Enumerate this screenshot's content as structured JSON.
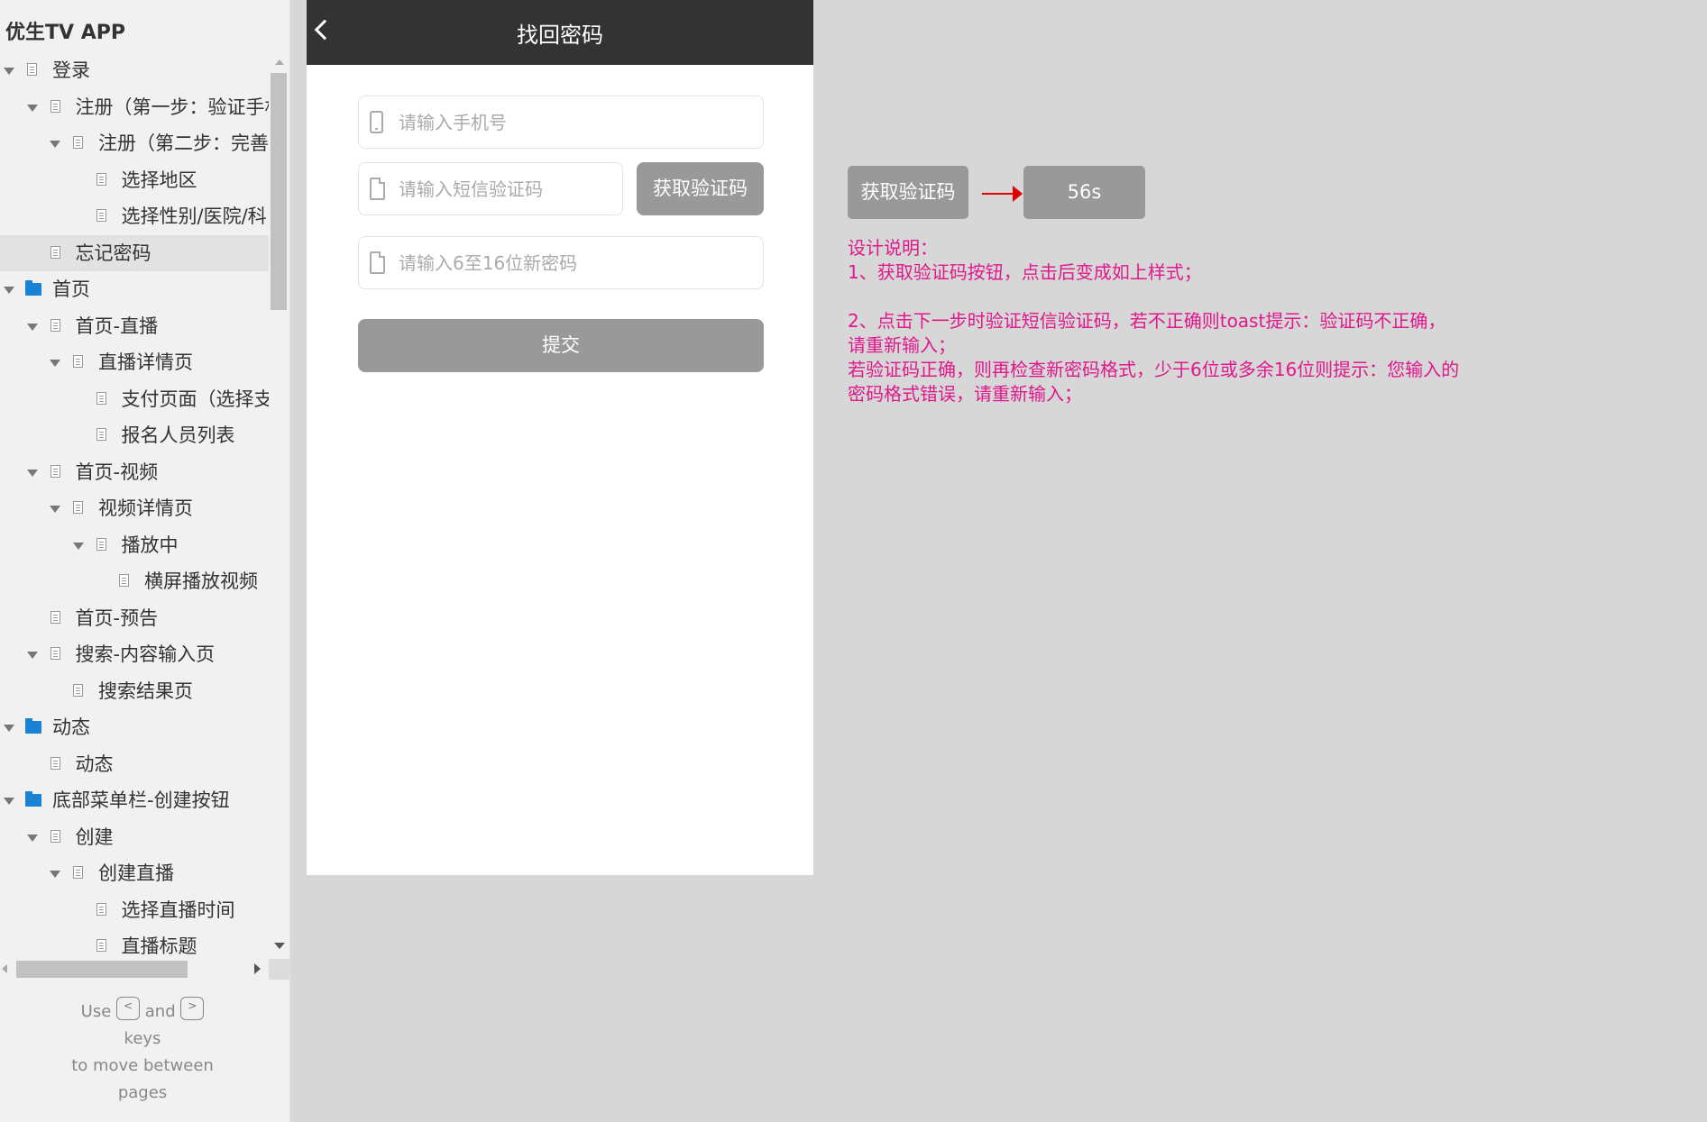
{
  "sidebar": {
    "title": "优生TV APP",
    "tree": [
      {
        "label": "登录",
        "level": 0,
        "expanded": true,
        "type": "page",
        "selected": false
      },
      {
        "label": "注册（第一步：验证手机",
        "level": 1,
        "expanded": true,
        "type": "page",
        "selected": false
      },
      {
        "label": "注册（第二步：完善",
        "level": 2,
        "expanded": true,
        "type": "page",
        "selected": false
      },
      {
        "label": "选择地区",
        "level": 3,
        "expanded": null,
        "type": "page",
        "selected": false
      },
      {
        "label": "选择性别/医院/科",
        "level": 3,
        "expanded": null,
        "type": "page",
        "selected": false
      },
      {
        "label": "忘记密码",
        "level": 1,
        "expanded": null,
        "type": "page",
        "selected": true
      },
      {
        "label": "首页",
        "level": 0,
        "expanded": true,
        "type": "folder",
        "selected": false
      },
      {
        "label": "首页-直播",
        "level": 1,
        "expanded": true,
        "type": "page",
        "selected": false
      },
      {
        "label": "直播详情页",
        "level": 2,
        "expanded": true,
        "type": "page",
        "selected": false
      },
      {
        "label": "支付页面（选择支",
        "level": 3,
        "expanded": null,
        "type": "page",
        "selected": false
      },
      {
        "label": "报名人员列表",
        "level": 3,
        "expanded": null,
        "type": "page",
        "selected": false
      },
      {
        "label": "首页-视频",
        "level": 1,
        "expanded": true,
        "type": "page",
        "selected": false
      },
      {
        "label": "视频详情页",
        "level": 2,
        "expanded": true,
        "type": "page",
        "selected": false
      },
      {
        "label": "播放中",
        "level": 3,
        "expanded": true,
        "type": "page",
        "selected": false
      },
      {
        "label": "横屏播放视频",
        "level": 4,
        "expanded": null,
        "type": "page",
        "selected": false
      },
      {
        "label": "首页-预告",
        "level": 1,
        "expanded": null,
        "type": "page",
        "selected": false
      },
      {
        "label": "搜索-内容输入页",
        "level": 1,
        "expanded": true,
        "type": "page",
        "selected": false
      },
      {
        "label": "搜索结果页",
        "level": 2,
        "expanded": null,
        "type": "page",
        "selected": false
      },
      {
        "label": "动态",
        "level": 0,
        "expanded": true,
        "type": "folder",
        "selected": false
      },
      {
        "label": "动态",
        "level": 1,
        "expanded": null,
        "type": "page",
        "selected": false
      },
      {
        "label": "底部菜单栏-创建按钮",
        "level": 0,
        "expanded": true,
        "type": "folder",
        "selected": false
      },
      {
        "label": "创建",
        "level": 1,
        "expanded": true,
        "type": "page",
        "selected": false
      },
      {
        "label": "创建直播",
        "level": 2,
        "expanded": true,
        "type": "page",
        "selected": false
      },
      {
        "label": "选择直播时间",
        "level": 3,
        "expanded": null,
        "type": "page",
        "selected": false
      },
      {
        "label": "直播标题",
        "level": 3,
        "expanded": null,
        "type": "page",
        "selected": false
      }
    ],
    "keys_hint": {
      "use": "Use",
      "prev_key": "<",
      "and": "and",
      "next_key": ">",
      "keys": "keys",
      "line2": "to move between",
      "line3": "pages"
    }
  },
  "phone": {
    "title": "找回密码",
    "phone_placeholder": "请输入手机号",
    "sms_placeholder": "请输入短信验证码",
    "get_code_label": "获取验证码",
    "password_placeholder": "请输入6至16位新密码",
    "submit_label": "提交"
  },
  "annotation": {
    "before_label": "获取验证码",
    "after_label": "56s",
    "arrow_color": "#e00000",
    "text_color": "#e0188c",
    "notes": [
      "设计说明：",
      "1、获取验证码按钮，点击后变成如上样式；",
      "",
      "2、点击下一步时验证短信验证码，若不正确则toast提示：验证码不正确，请重新输入；",
      "若验证码正确，则再检查新密码格式，少于6位或多余16位则提示：您输入的密码格式错误，请重新输入；"
    ]
  }
}
